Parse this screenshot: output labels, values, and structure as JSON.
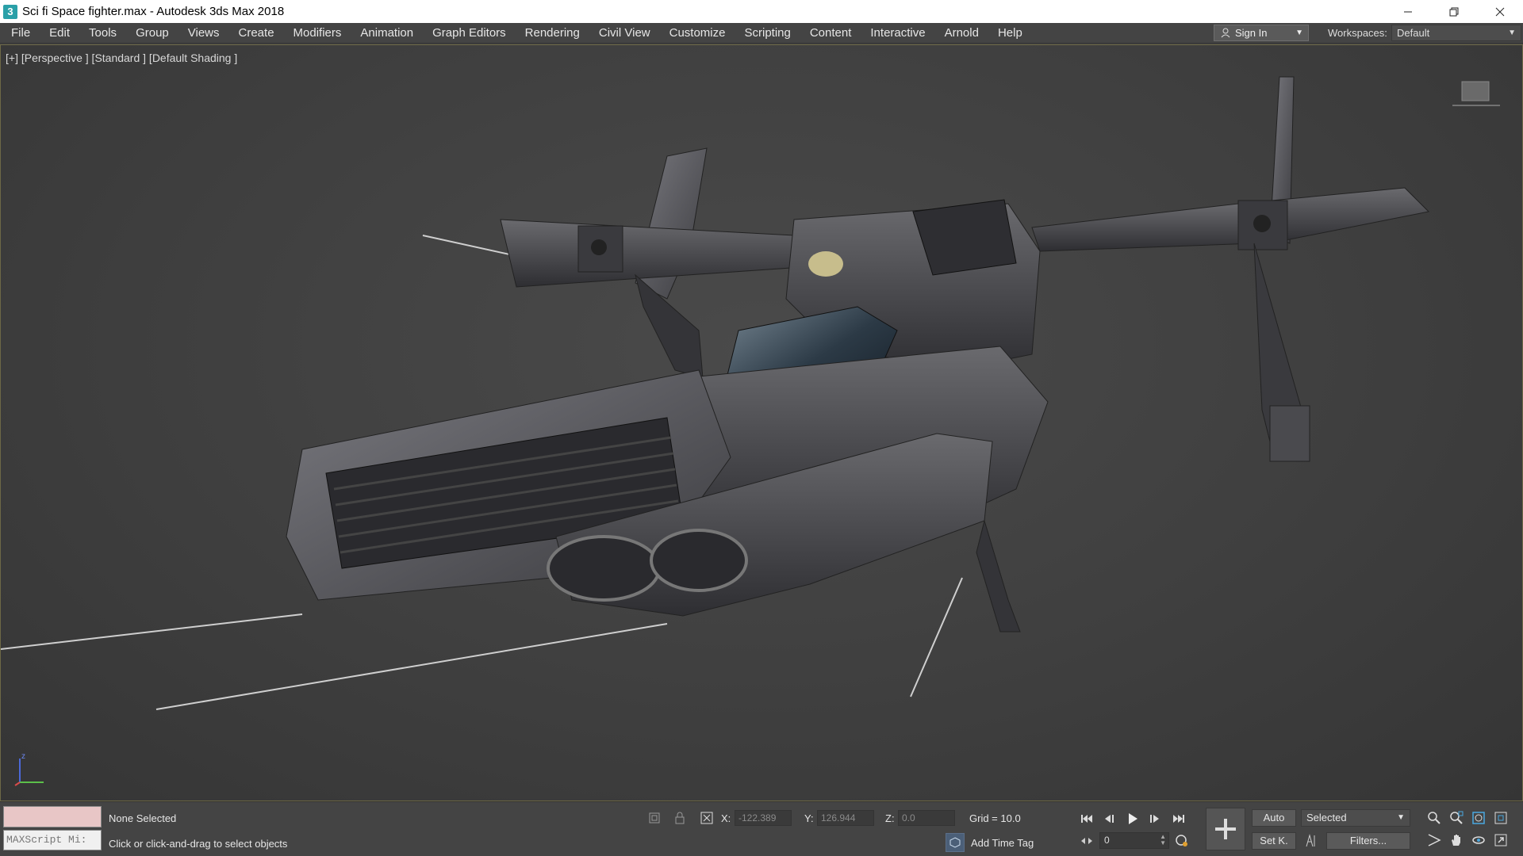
{
  "window": {
    "title": "Sci fi Space fighter.max - Autodesk 3ds Max 2018",
    "app_icon_glyph": "3",
    "controls": [
      "minimize-icon",
      "restore-icon",
      "close-icon"
    ]
  },
  "menu": {
    "items": [
      "File",
      "Edit",
      "Tools",
      "Group",
      "Views",
      "Create",
      "Modifiers",
      "Animation",
      "Graph Editors",
      "Rendering",
      "Civil View",
      "Customize",
      "Scripting",
      "Content",
      "Interactive",
      "Arnold",
      "Help"
    ],
    "signin_label": "Sign In",
    "workspaces_label": "Workspaces:",
    "workspace_value": "Default"
  },
  "viewport": {
    "label": "[+] [Perspective ] [Standard ] [Default Shading ]",
    "border_color": "#6d6846",
    "object": "sci-fi space fighter model",
    "axis_label": "z"
  },
  "status": {
    "selection": "None Selected",
    "prompt": "Click or click-and-drag to select objects",
    "maxscript_placeholder": "MAXScript Mi:",
    "coords": {
      "x_label": "X:",
      "x_value": "-122.389",
      "y_label": "Y:",
      "y_value": "126.944",
      "z_label": "Z:",
      "z_value": "0.0"
    },
    "grid": "Grid = 10.0",
    "time_tag": "Add Time Tag"
  },
  "animation": {
    "frame_value": "0",
    "auto_key_label": "Auto",
    "set_key_label": "Set K.",
    "key_filter_value": "Selected",
    "filters_label": "Filters..."
  },
  "colors": {
    "ui_bg": "#444444",
    "mini_listener": "#e8c6c6",
    "timetag_icon": "#4b5f78"
  }
}
